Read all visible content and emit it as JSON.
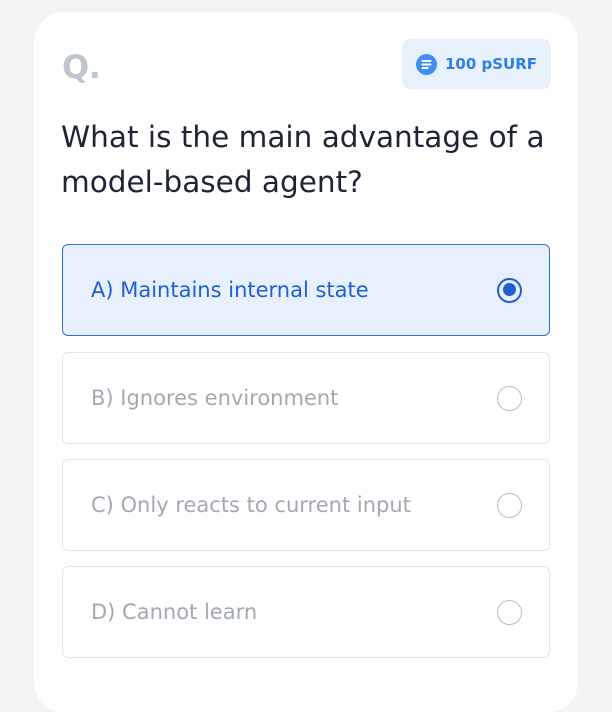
{
  "quiz": {
    "question_marker": "Q.",
    "reward": {
      "icon": "coin-icon",
      "label": "100 pSURF"
    },
    "question": "What is the main advantage of a model-based agent?",
    "selected_option_index": 0,
    "options": [
      {
        "label": "A) Maintains internal state",
        "selected": true
      },
      {
        "label": "B) Ignores environment",
        "selected": false
      },
      {
        "label": "C) Only reacts to current input",
        "selected": false
      },
      {
        "label": "D) Cannot learn",
        "selected": false
      }
    ]
  },
  "colors": {
    "accent": "#1e5fd6",
    "selected_background": "#e8effd",
    "badge_background": "#e6f1fb",
    "muted_text": "#a3a9b3"
  }
}
